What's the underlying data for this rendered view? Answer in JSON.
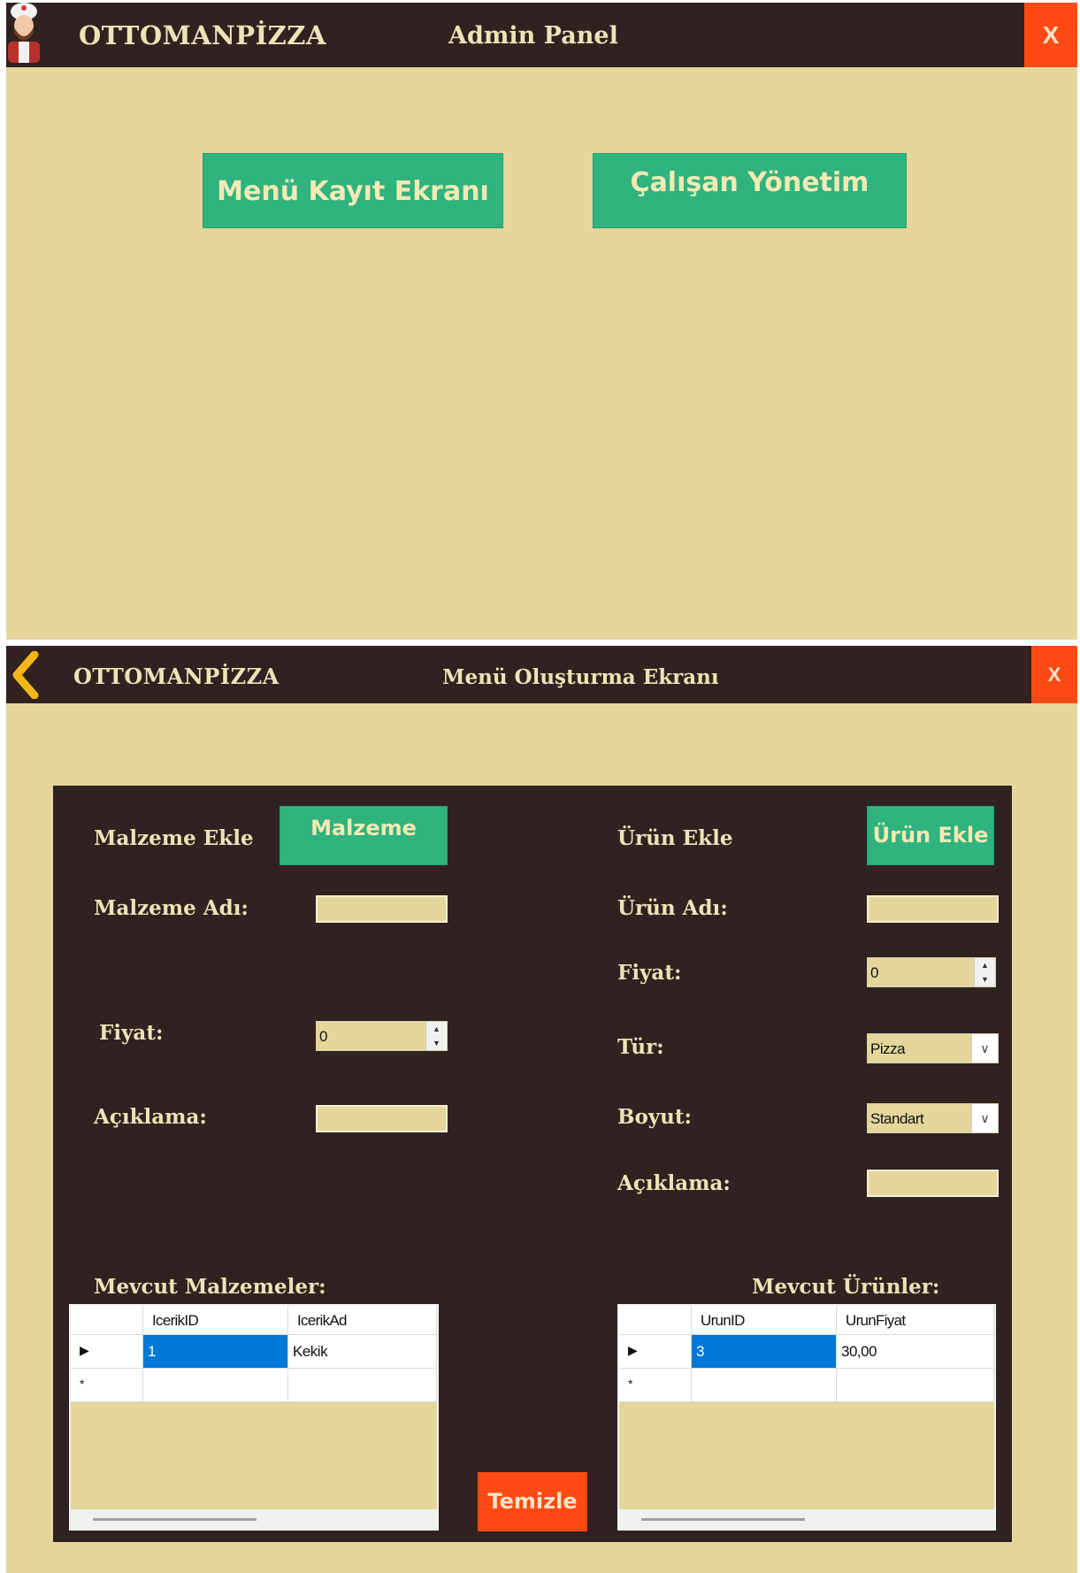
{
  "admin_window": {
    "brand": "OTTOMANPİZZA",
    "title": "Admin Panel",
    "close_label": "X",
    "buttons": {
      "menu_record": "Menü Kayıt Ekranı",
      "employee_management": "Çalışan Yönetim"
    }
  },
  "menu_window": {
    "back_icon": "chevron-left-icon",
    "brand": "OTTOMANPİZZA",
    "title": "Menü Oluşturma Ekranı",
    "close_label": "X",
    "ingredient": {
      "section_label": "Malzeme Ekle",
      "add_button": "Malzeme",
      "name_label": "Malzeme Adı:",
      "name_value": "",
      "price_label": "Fiyat:",
      "price_value": "0",
      "desc_label": "Açıklama:",
      "desc_value": "",
      "list_label": "Mevcut Malzemeler:",
      "grid": {
        "columns": [
          "IcerikID",
          "IcerikAd"
        ],
        "rows": [
          [
            "1",
            "Kekik"
          ]
        ],
        "new_row_marker": "*",
        "current_row_marker": "▶"
      }
    },
    "product": {
      "section_label": "Ürün Ekle",
      "add_button": "Ürün Ekle",
      "name_label": "Ürün Adı:",
      "name_value": "",
      "price_label": "Fiyat:",
      "price_value": "0",
      "type_label": "Tür:",
      "type_value": "Pizza",
      "size_label": "Boyut:",
      "size_value": "Standart",
      "desc_label": "Açıklama:",
      "desc_value": "",
      "list_label": "Mevcut Ürünler:",
      "grid": {
        "columns": [
          "UrunID",
          "UrunFiyat"
        ],
        "rows": [
          [
            "3",
            "30,00"
          ]
        ],
        "new_row_marker": "*",
        "current_row_marker": "▶"
      }
    },
    "clear_button": "Temizle"
  },
  "colors": {
    "titlebar": "#2f2220",
    "background": "#e5d69b",
    "accent_green": "#2fb37f",
    "close_orange": "#ff4a14",
    "selection_blue": "#0078d7"
  }
}
